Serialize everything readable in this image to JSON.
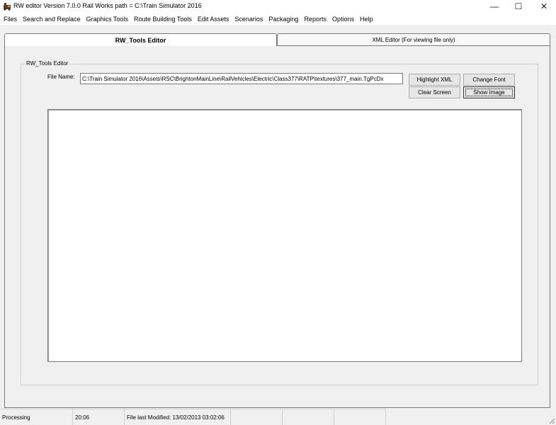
{
  "window": {
    "title": "RW editor  Version 7.0.0   Rail Works path = C:\\Train Simulator 2016",
    "app_icon": "train-icon",
    "controls": {
      "minimize": "—",
      "maximize": "☐",
      "close": "✕"
    }
  },
  "menu": [
    "Files",
    "Search and Replace",
    "Graphics Tools",
    "Route Building Tools",
    "Edit Assets",
    "Scenarios",
    "Packaging",
    "Reports",
    "Options",
    "Help"
  ],
  "tabs": {
    "active": "RW_Tools Editor",
    "inactive": "XML Editor (For viewing file only)"
  },
  "editor": {
    "group_title": "RW_Tools Editor",
    "file_label": "File Name:",
    "file_value": "C:\\Train Simulator 2016\\Assets\\RSC\\BrightonMainLine\\RailVehicles\\Electric\\Class377\\RATP\\textures\\377_main.TgPcDx",
    "buttons": {
      "highlight_xml": "Highlight XML",
      "change_font": "Change Font",
      "clear_screen": "Clear Screen",
      "show_image": "Show Image"
    }
  },
  "status": {
    "state": "Processing",
    "time": "20:06",
    "modified": "File last Modified: 13/02/2013 03:02:06",
    "panel4": "",
    "panel5": "",
    "panel6": ""
  }
}
